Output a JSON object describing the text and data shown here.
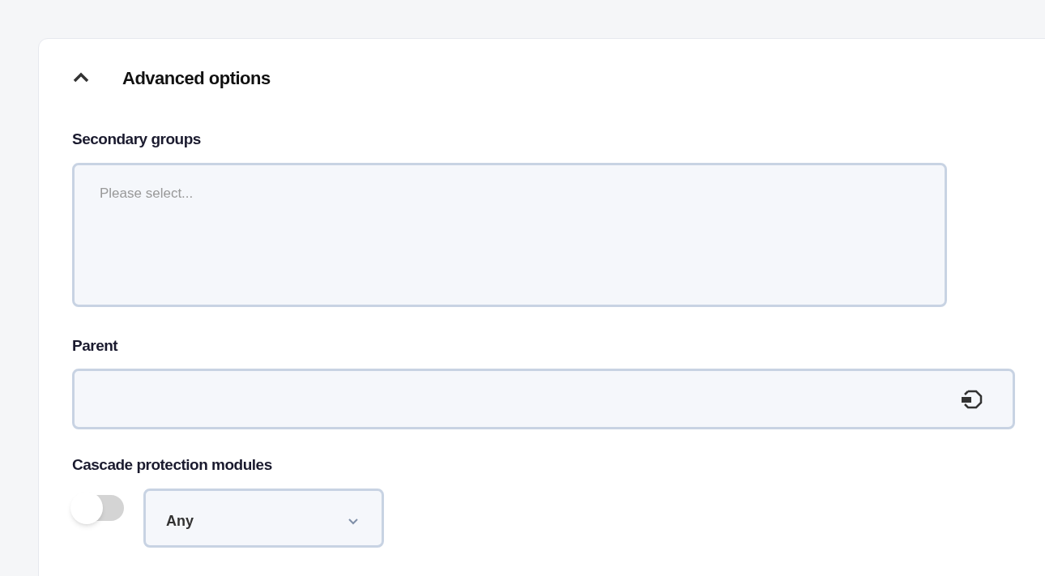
{
  "section": {
    "title": "Advanced options",
    "expanded": true
  },
  "secondary_groups": {
    "label": "Secondary groups",
    "placeholder": "Please select..."
  },
  "parent": {
    "label": "Parent"
  },
  "cascade": {
    "label": "Cascade protection modules",
    "toggle_on": false,
    "select_value": "Any"
  }
}
